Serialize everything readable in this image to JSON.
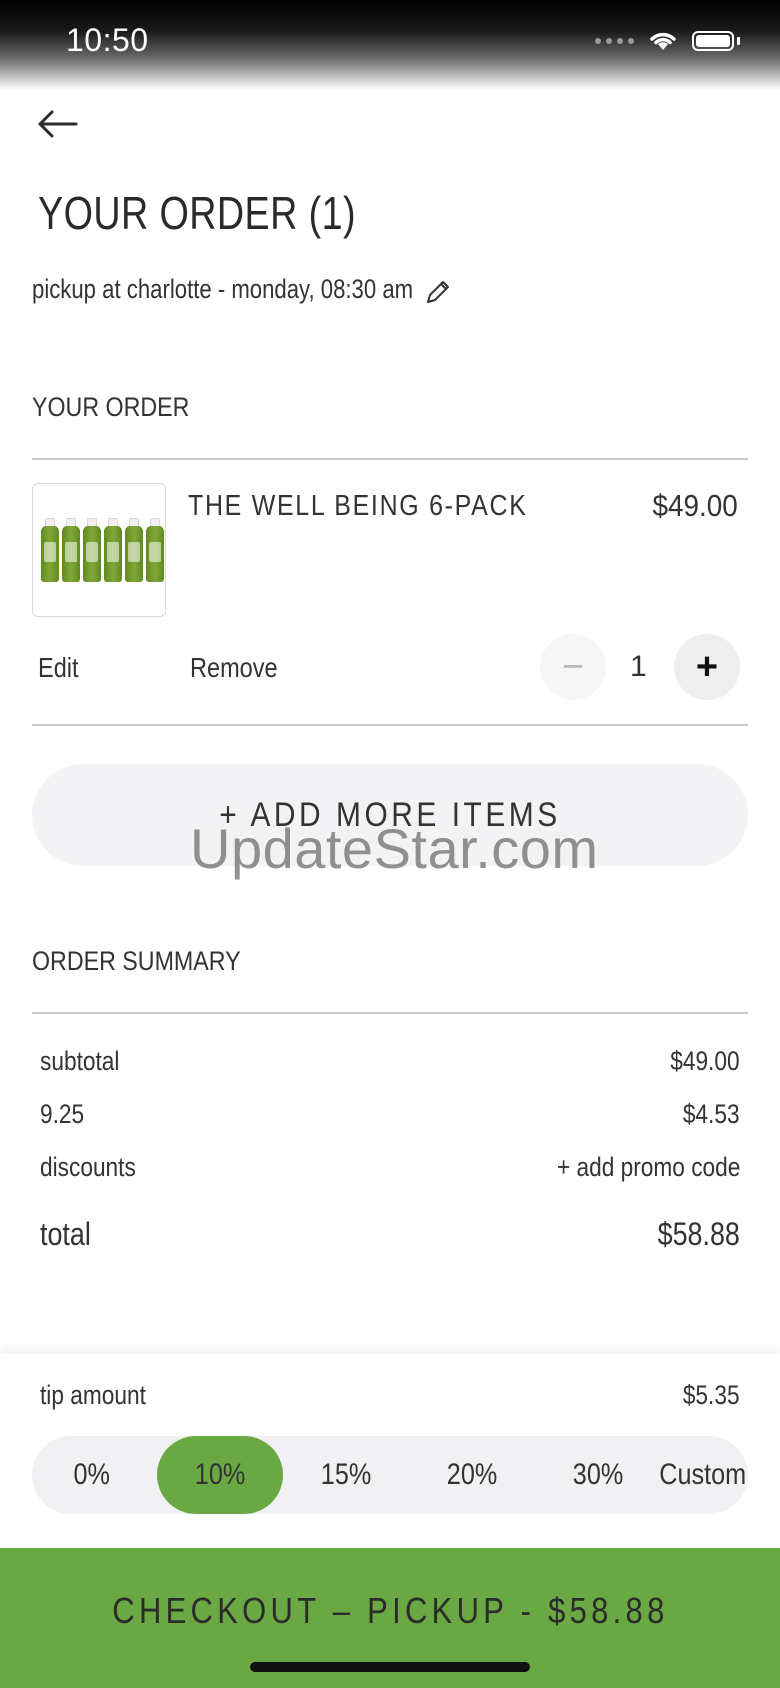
{
  "status_bar": {
    "time": "10:50"
  },
  "header": {
    "title": "YOUR ORDER (1)",
    "pickup_info": "pickup at charlotte - monday, 08:30 am"
  },
  "order_section": {
    "heading": "YOUR ORDER",
    "items": [
      {
        "name": "THE WELL BEING 6-PACK",
        "price": "$49.00",
        "edit_label": "Edit",
        "remove_label": "Remove",
        "quantity": "1",
        "minus_label": "−",
        "plus_label": "+"
      }
    ],
    "add_more_label": "+ ADD MORE ITEMS"
  },
  "watermark": "UpdateStar.com",
  "summary": {
    "heading": "ORDER SUMMARY",
    "rows": [
      {
        "label": "subtotal",
        "value": "$49.00"
      },
      {
        "label": "9.25",
        "value": "$4.53"
      },
      {
        "label": "discounts",
        "value": "+ add promo code"
      }
    ],
    "total_label": "total",
    "total_value": "$58.88"
  },
  "tip": {
    "label": "tip amount",
    "amount": "$5.35",
    "options": [
      "0%",
      "10%",
      "15%",
      "20%",
      "30%",
      "Custom"
    ],
    "selected": "10%"
  },
  "checkout": {
    "label": "CHECKOUT – PICKUP - $58.88"
  },
  "colors": {
    "accent_green": "#6aa843",
    "segment_bg": "#f1f1f4",
    "text": "#2b2b2b"
  }
}
